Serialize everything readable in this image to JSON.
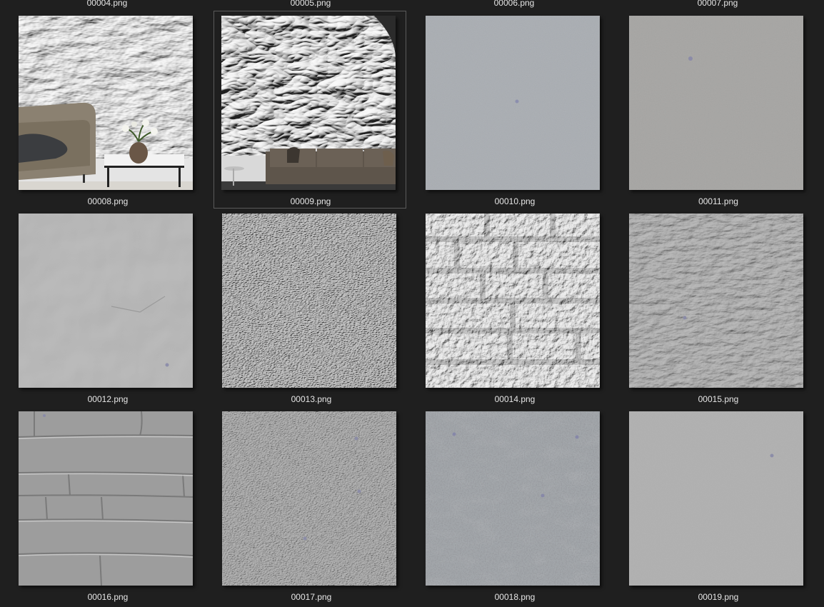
{
  "top_row_labels": [
    "00004.png",
    "00005.png",
    "00006.png",
    "00007.png"
  ],
  "files": [
    {
      "name": "00008.png",
      "kind": "room-sofa-plaster",
      "selected": false
    },
    {
      "name": "00009.png",
      "kind": "room-sofa-swirl",
      "selected": true
    },
    {
      "name": "00010.png",
      "kind": "flat-plaster",
      "selected": false
    },
    {
      "name": "00011.png",
      "kind": "flat-plaster-warm",
      "selected": false
    },
    {
      "name": "00012.png",
      "kind": "smooth-plaster",
      "selected": false
    },
    {
      "name": "00013.png",
      "kind": "fine-texture",
      "selected": false
    },
    {
      "name": "00014.png",
      "kind": "white-brick",
      "selected": false
    },
    {
      "name": "00015.png",
      "kind": "cracked-plaster",
      "selected": false
    },
    {
      "name": "00016.png",
      "kind": "grey-brick",
      "selected": false
    },
    {
      "name": "00017.png",
      "kind": "fine-texture-grey",
      "selected": false
    },
    {
      "name": "00018.png",
      "kind": "concrete",
      "selected": false
    },
    {
      "name": "00019.png",
      "kind": "flat-plaster-light",
      "selected": false
    }
  ]
}
